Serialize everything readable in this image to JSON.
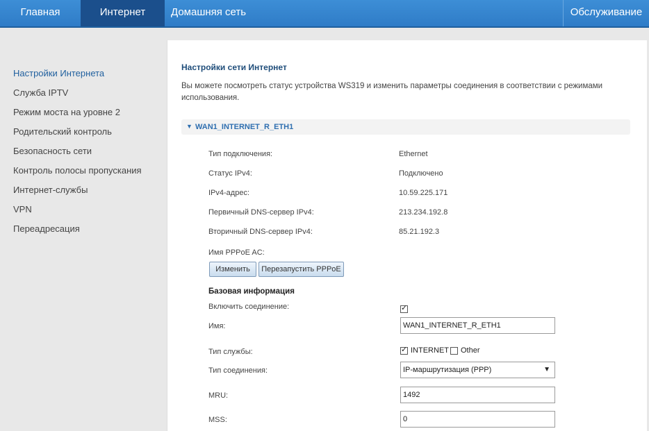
{
  "nav": {
    "home": "Главная",
    "internet": "Интернет",
    "home_network": "Домашняя сеть",
    "maintenance": "Обслуживание"
  },
  "sidebar": {
    "items": [
      {
        "label": "Настройки Интернета"
      },
      {
        "label": "Служба IPTV"
      },
      {
        "label": "Режим моста на уровне 2"
      },
      {
        "label": "Родительский контроль"
      },
      {
        "label": "Безопасность сети"
      },
      {
        "label": "Контроль полосы пропускания"
      },
      {
        "label": "Интернет-службы"
      },
      {
        "label": "VPN"
      },
      {
        "label": "Переадресация"
      }
    ]
  },
  "main": {
    "title": "Настройки сети Интернет",
    "description": "Вы можете посмотреть статус устройства WS319 и изменить параметры соединения в соответствии с режимами использования.",
    "section_title": "WAN1_INTERNET_R_ETH1",
    "status": {
      "conn_type_label": "Тип подключения:",
      "conn_type_value": "Ethernet",
      "ipv4_status_label": "Статус IPv4:",
      "ipv4_status_value": "Подключено",
      "ipv4_addr_label": "IPv4-адрес:",
      "ipv4_addr_value": "10.59.225.171",
      "dns1_label": "Первичный DNS-сервер IPv4:",
      "dns1_value": "213.234.192.8",
      "dns2_label": "Вторичный DNS-сервер IPv4:",
      "dns2_value": "85.21.192.3",
      "pppoe_ac_label": "Имя PPPoE AC:"
    },
    "buttons": {
      "change": "Изменить",
      "restart_pppoe": "Перезапустить PPPoE"
    },
    "basic": {
      "heading": "Базовая информация",
      "enable_label": "Включить соединение:",
      "enable_checked": true,
      "name_label": "Имя:",
      "name_value": "WAN1_INTERNET_R_ETH1",
      "service_label": "Тип службы:",
      "service_internet": "INTERNET",
      "service_internet_checked": true,
      "service_other": "Other",
      "service_other_checked": false,
      "conn_mode_label": "Тип соединения:",
      "conn_mode_value": "IP-маршрутизация (PPP)",
      "mru_label": "MRU:",
      "mru_value": "1492",
      "mss_label": "MSS:",
      "mss_value": "0"
    }
  }
}
